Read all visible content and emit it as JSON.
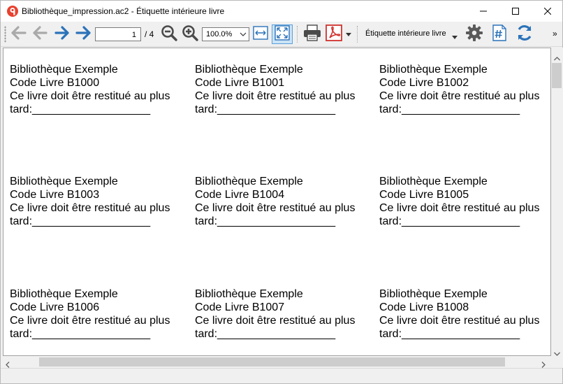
{
  "window": {
    "title": "Bibliothèque_impression.ac2 - Étiquette intérieure livre"
  },
  "toolbar": {
    "page_value": "1",
    "page_total": "/ 4",
    "zoom_value": "100.0%",
    "layout_value": "Étiquette intérieure livre",
    "overflow": "»"
  },
  "labels": [
    {
      "line1": "Bibliothèque Exemple",
      "line2": "Code Livre B1000",
      "line3": "Ce livre doit être restitué au plus",
      "line4": "tard:___________________"
    },
    {
      "line1": "Bibliothèque Exemple",
      "line2": "Code Livre B1001",
      "line3": "Ce livre doit être restitué au plus",
      "line4": "tard:___________________"
    },
    {
      "line1": "Bibliothèque Exemple",
      "line2": "Code Livre B1002",
      "line3": "Ce livre doit être restitué au plus",
      "line4": "tard:___________________"
    },
    {
      "line1": "Bibliothèque Exemple",
      "line2": "Code Livre B1003",
      "line3": "Ce livre doit être restitué au plus",
      "line4": "tard:___________________"
    },
    {
      "line1": "Bibliothèque Exemple",
      "line2": "Code Livre B1004",
      "line3": "Ce livre doit être restitué au plus",
      "line4": "tard:___________________"
    },
    {
      "line1": "Bibliothèque Exemple",
      "line2": "Code Livre B1005",
      "line3": "Ce livre doit être restitué au plus",
      "line4": "tard:___________________"
    },
    {
      "line1": "Bibliothèque Exemple",
      "line2": "Code Livre B1006",
      "line3": "Ce livre doit être restitué au plus",
      "line4": "tard:___________________"
    },
    {
      "line1": "Bibliothèque Exemple",
      "line2": "Code Livre B1007",
      "line3": "Ce livre doit être restitué au plus",
      "line4": "tard:___________________"
    },
    {
      "line1": "Bibliothèque Exemple",
      "line2": "Code Livre B1008",
      "line3": "Ce livre doit être restitué au plus",
      "line4": "tard:___________________"
    }
  ],
  "icons": {
    "app": "app-logo-icon",
    "first": "first-page-arrow-icon",
    "prev": "previous-page-arrow-icon",
    "next": "next-page-arrow-icon",
    "last": "last-page-arrow-icon",
    "zoom_out": "zoom-out-icon",
    "zoom_in": "zoom-in-icon",
    "fit_width": "fit-width-icon",
    "fit_page": "fit-page-icon",
    "print": "printer-icon",
    "pdf": "pdf-icon",
    "settings": "gear-icon",
    "numbering": "hash-icon",
    "refresh": "refresh-icon"
  },
  "colors": {
    "accent": "#2b72b9",
    "pdf_red": "#d0312d",
    "active_bg": "#cce4f7"
  }
}
